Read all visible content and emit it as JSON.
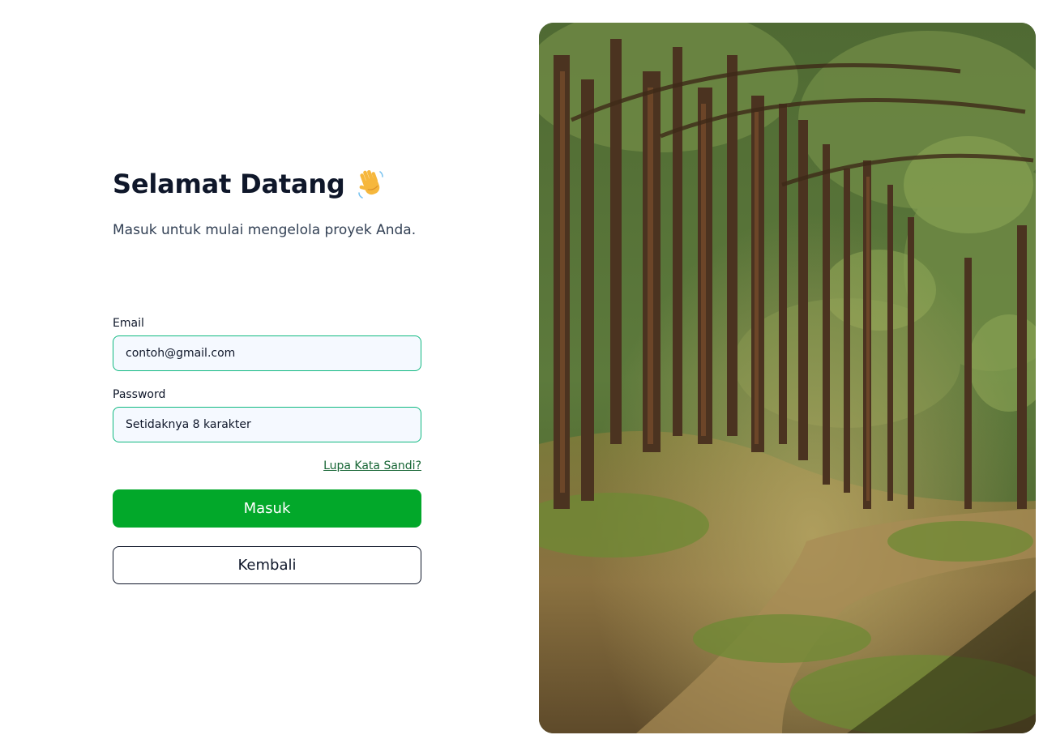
{
  "header": {
    "title": "Selamat Datang",
    "wave_icon": "waving-hand-icon",
    "subtitle": "Masuk untuk mulai mengelola proyek Anda."
  },
  "form": {
    "email": {
      "label": "Email",
      "placeholder": "contoh@gmail.com",
      "value": ""
    },
    "password": {
      "label": "Password",
      "placeholder": "Setidaknya 8 karakter",
      "value": ""
    },
    "forgot_link": "Lupa Kata Sandi?",
    "submit_label": "Masuk",
    "back_label": "Kembali"
  },
  "hero": {
    "image": "forest-path-photo"
  },
  "colors": {
    "accent": "#02a82a",
    "field_border": "#10b981",
    "field_bg": "#f5f9ff",
    "link": "#166534",
    "text": "#0f172a"
  }
}
